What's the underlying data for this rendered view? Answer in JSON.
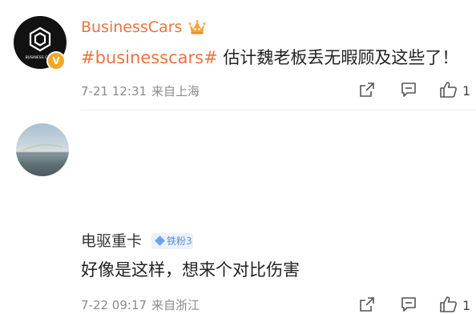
{
  "comments": [
    {
      "username": "BusinessCars",
      "verified_mark": "V",
      "hashtag": "#businesscars#",
      "text": " 估计魏老板丢无暇顾及这些了！",
      "time": "7-21 12:31",
      "source": "来自上海",
      "likes": "1",
      "avatar_text": "BUSINESS CARS",
      "icons": [
        "crown-icon",
        "share-icon",
        "comment-icon",
        "like-icon"
      ]
    },
    {
      "username": "电驱重卡",
      "fan_badge": "铁粉3",
      "text": "好像是这样，想来个对比伤害",
      "time": "7-22 09:17",
      "source": "来自浙江",
      "likes": "1",
      "icons": [
        "diamond-icon",
        "share-icon",
        "comment-icon",
        "like-icon"
      ]
    }
  ],
  "colors": {
    "username_highlight": "#eb7340",
    "meta_gray": "#8a8a8a",
    "fan_badge_blue": "#5b8fd6"
  }
}
